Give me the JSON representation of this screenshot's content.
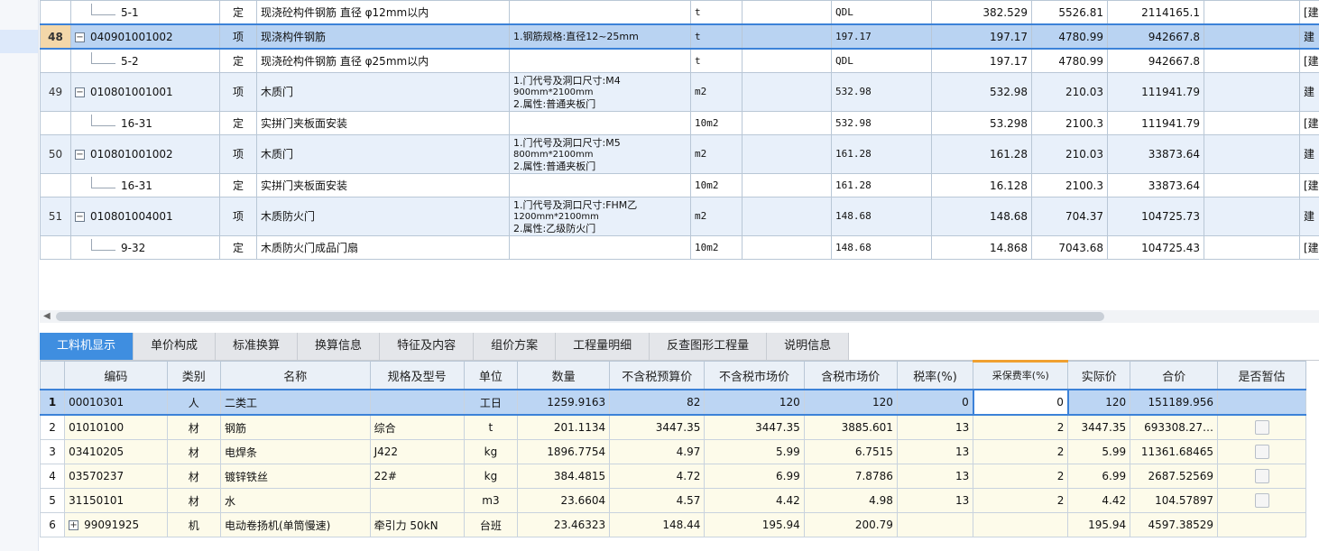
{
  "top_rows": [
    {
      "kind": "sub",
      "num": "",
      "code": "5-1",
      "type": "定",
      "name": "现浇砼构件钢筋 直径 φ12mm以内",
      "desc": "",
      "unit": "t",
      "c7": "",
      "qty_expr": "QDL",
      "qty": "382.529",
      "price": "5526.81",
      "total": "2114165.1",
      "last": "[建"
    },
    {
      "kind": "item",
      "selected": true,
      "num": "48",
      "code": "040901001002",
      "type": "项",
      "name": "现浇构件钢筋",
      "desc": "1.钢筋规格:直径12~25mm",
      "unit": "t",
      "c7": "",
      "qty_expr": "197.17",
      "qty": "197.17",
      "price": "4780.99",
      "total": "942667.8",
      "last": "建"
    },
    {
      "kind": "sub",
      "num": "",
      "code": "5-2",
      "type": "定",
      "name": "现浇砼构件钢筋 直径 φ25mm以内",
      "desc": "",
      "unit": "t",
      "c7": "",
      "qty_expr": "QDL",
      "qty": "197.17",
      "price": "4780.99",
      "total": "942667.8",
      "last": "[建"
    },
    {
      "kind": "item",
      "tall": true,
      "num": "49",
      "code": "010801001001",
      "type": "项",
      "name": "木质门",
      "desc1": "1.门代号及洞口尺寸:M4",
      "desc2": "900mm*2100mm",
      "desc3": "2.属性:普通夹板门",
      "unit": "m2",
      "c7": "",
      "qty_expr": "532.98",
      "qty": "532.98",
      "price": "210.03",
      "total": "111941.79",
      "last": "建"
    },
    {
      "kind": "sub",
      "num": "",
      "code": "16-31",
      "type": "定",
      "name": "实拼门夹板面安装",
      "desc": "",
      "unit": "10m2",
      "c7": "",
      "qty_expr": "532.98",
      "qty": "53.298",
      "price": "2100.3",
      "total": "111941.79",
      "last": "[建"
    },
    {
      "kind": "item",
      "tall": true,
      "num": "50",
      "code": "010801001002",
      "type": "项",
      "name": "木质门",
      "desc1": "1.门代号及洞口尺寸:M5",
      "desc2": "800mm*2100mm",
      "desc3": "2.属性:普通夹板门",
      "unit": "m2",
      "c7": "",
      "qty_expr": "161.28",
      "qty": "161.28",
      "price": "210.03",
      "total": "33873.64",
      "last": "建"
    },
    {
      "kind": "sub",
      "num": "",
      "code": "16-31",
      "type": "定",
      "name": "实拼门夹板面安装",
      "desc": "",
      "unit": "10m2",
      "c7": "",
      "qty_expr": "161.28",
      "qty": "16.128",
      "price": "2100.3",
      "total": "33873.64",
      "last": "[建"
    },
    {
      "kind": "item",
      "tall": true,
      "num": "51",
      "code": "010801004001",
      "type": "项",
      "name": "木质防火门",
      "desc1": "1.门代号及洞口尺寸:FHM乙",
      "desc2": "1200mm*2100mm",
      "desc3": "2.属性:乙级防火门",
      "unit": "m2",
      "c7": "",
      "qty_expr": "148.68",
      "qty": "148.68",
      "price": "704.37",
      "total": "104725.73",
      "last": "建"
    },
    {
      "kind": "sub",
      "num": "",
      "code": "9-32",
      "type": "定",
      "name": "木质防火门成品门扇",
      "desc": "",
      "unit": "10m2",
      "c7": "",
      "qty_expr": "148.68",
      "qty": "14.868",
      "price": "7043.68",
      "total": "104725.43",
      "last": "[建"
    }
  ],
  "tabs": [
    "工料机显示",
    "单价构成",
    "标准换算",
    "换算信息",
    "特征及内容",
    "组价方案",
    "工程量明细",
    "反查图形工程量",
    "说明信息"
  ],
  "active_tab": 0,
  "bottom_headers": [
    "编码",
    "类别",
    "名称",
    "规格及型号",
    "单位",
    "数量",
    "不含税预算价",
    "不含税市场价",
    "含税市场价",
    "税率(%)",
    "采保费率(%)",
    "实际价",
    "合价",
    "是否暂估"
  ],
  "bottom_rows": [
    {
      "idx": "1",
      "code": "00010301",
      "cat": "人",
      "name": "二类工",
      "spec": "",
      "unit": "工日",
      "qty": "1259.9163",
      "budget": "82",
      "market": "120",
      "tax_market": "120",
      "tax_rate": "0",
      "fee_rate": "0",
      "actual": "120",
      "total": "151189.956",
      "temp": false,
      "selected": true
    },
    {
      "idx": "2",
      "code": "01010100",
      "cat": "材",
      "name": "钢筋",
      "spec": "综合",
      "unit": "t",
      "qty": "201.1134",
      "budget": "3447.35",
      "market": "3447.35",
      "tax_market": "3885.601",
      "tax_rate": "13",
      "fee_rate": "2",
      "actual": "3447.35",
      "total": "693308.27…",
      "temp": true
    },
    {
      "idx": "3",
      "code": "03410205",
      "cat": "材",
      "name": "电焊条",
      "spec": "J422",
      "unit": "kg",
      "qty": "1896.7754",
      "budget": "4.97",
      "market": "5.99",
      "tax_market": "6.7515",
      "tax_rate": "13",
      "fee_rate": "2",
      "actual": "5.99",
      "total": "11361.68465",
      "temp": true
    },
    {
      "idx": "4",
      "code": "03570237",
      "cat": "材",
      "name": "镀锌铁丝",
      "spec": "22#",
      "unit": "kg",
      "qty": "384.4815",
      "budget": "4.72",
      "market": "6.99",
      "tax_market": "7.8786",
      "tax_rate": "13",
      "fee_rate": "2",
      "actual": "6.99",
      "total": "2687.52569",
      "temp": true
    },
    {
      "idx": "5",
      "code": "31150101",
      "cat": "材",
      "name": "水",
      "spec": "",
      "unit": "m3",
      "qty": "23.6604",
      "budget": "4.57",
      "market": "4.42",
      "tax_market": "4.98",
      "tax_rate": "13",
      "fee_rate": "2",
      "actual": "4.42",
      "total": "104.57897",
      "temp": true
    },
    {
      "idx": "6",
      "code": "99091925",
      "cat": "机",
      "name": "电动卷扬机(单筒慢速)",
      "spec": "牵引力 50kN",
      "unit": "台班",
      "qty": "23.46323",
      "budget": "148.44",
      "market": "195.94",
      "tax_market": "200.79",
      "tax_rate": "",
      "fee_rate": "",
      "actual": "195.94",
      "total": "4597.38529",
      "temp": false,
      "expand": true
    }
  ]
}
